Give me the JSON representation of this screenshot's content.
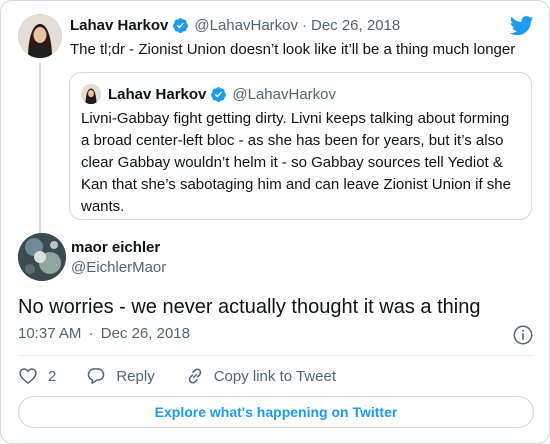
{
  "colors": {
    "brand": "#1d9bf0",
    "text": "#0f1419",
    "muted": "#536471",
    "border": "#cfd9de"
  },
  "parent_tweet": {
    "name": "Lahav Harkov",
    "handle": "@LahavHarkov",
    "separator": "·",
    "date": "Dec 26, 2018",
    "text": "The tl;dr - Zionist Union doesn’t look like it’ll be a thing much longer",
    "verified": true,
    "avatar_icon": "profile-photo"
  },
  "quote_tweet": {
    "name": "Lahav Harkov",
    "handle": "@LahavHarkov",
    "verified": true,
    "text": "Livni-Gabbay fight getting dirty. Livni keeps talking about forming a broad center-left bloc - as she has been for years, but it’s also clear Gabbay wouldn’t helm it - so Gabbay sources tell Yediot & Kan that she’s sabotaging him and can leave Zionist Union if she wants."
  },
  "reply_tweet": {
    "name": "maor eichler",
    "handle": "@EichlerMaor",
    "text": "No worries - we never actually thought it was a thing",
    "time": "10:37 AM",
    "separator": "·",
    "date": "Dec 26, 2018"
  },
  "actions": {
    "like_count": "2",
    "reply_label": "Reply",
    "copy_label": "Copy link to Tweet"
  },
  "explore_label": "Explore what's happening on Twitter",
  "icons": {
    "logo": "twitter-bird-icon",
    "verified": "verified-badge-icon",
    "info": "info-icon",
    "like": "heart-icon",
    "reply": "reply-bubble-icon",
    "copy": "link-icon"
  }
}
